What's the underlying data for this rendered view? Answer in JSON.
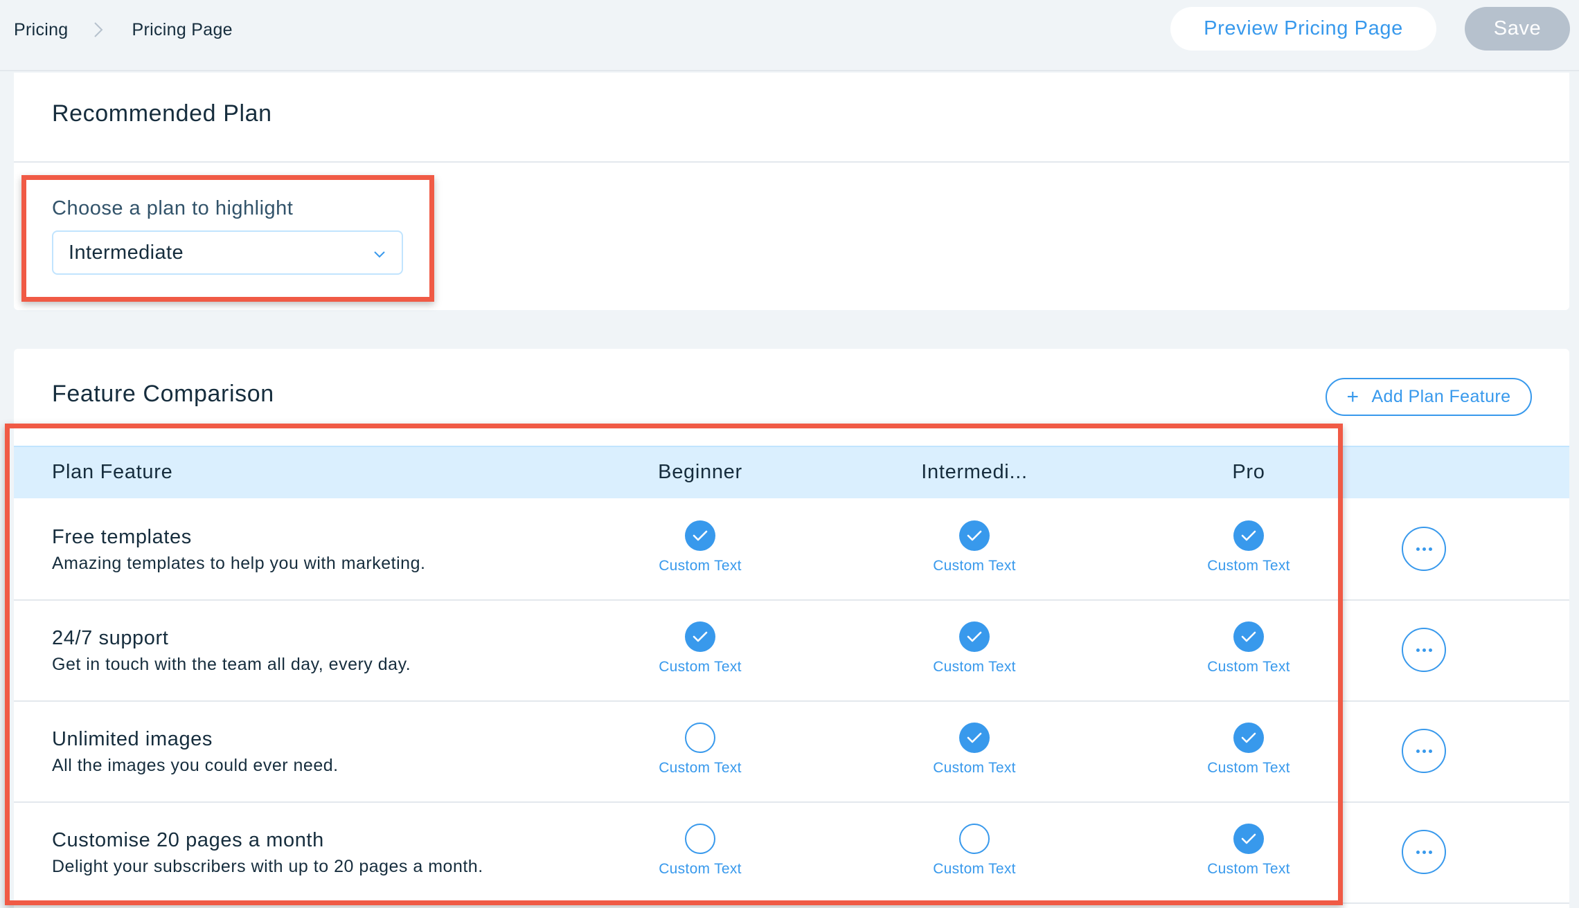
{
  "breadcrumb": {
    "items": [
      "Pricing",
      "Pricing Page"
    ]
  },
  "header": {
    "preview_label": "Preview Pricing Page",
    "save_label": "Save"
  },
  "recommended": {
    "title": "Recommended Plan",
    "choose_label": "Choose a plan to highlight",
    "selected_plan": "Intermediate"
  },
  "comparison": {
    "title": "Feature Comparison",
    "add_label": "Add Plan Feature",
    "columns": {
      "feature": "Plan Feature",
      "plans": [
        "Beginner",
        "Intermedi...",
        "Pro"
      ]
    },
    "rows": [
      {
        "title": "Free templates",
        "desc": "Amazing templates to help you with marketing.",
        "cells": [
          {
            "checked": true,
            "text": "Custom Text"
          },
          {
            "checked": true,
            "text": "Custom Text"
          },
          {
            "checked": true,
            "text": "Custom Text"
          }
        ]
      },
      {
        "title": "24/7 support",
        "desc": "Get in touch with the team all day, every day.",
        "cells": [
          {
            "checked": true,
            "text": "Custom Text"
          },
          {
            "checked": true,
            "text": "Custom Text"
          },
          {
            "checked": true,
            "text": "Custom Text"
          }
        ]
      },
      {
        "title": "Unlimited images",
        "desc": "All the images you could ever need.",
        "cells": [
          {
            "checked": false,
            "text": "Custom Text"
          },
          {
            "checked": true,
            "text": "Custom Text"
          },
          {
            "checked": true,
            "text": "Custom Text"
          }
        ]
      },
      {
        "title": "Customise 20 pages a month",
        "desc": "Delight your subscribers with up to 20 pages a month.",
        "cells": [
          {
            "checked": false,
            "text": "Custom Text"
          },
          {
            "checked": false,
            "text": "Custom Text"
          },
          {
            "checked": true,
            "text": "Custom Text"
          }
        ]
      }
    ]
  },
  "colors": {
    "accent": "#3899ec",
    "header_row": "#daeffe",
    "highlight_box": "#f05a45",
    "save_disabled": "#b6c1cd"
  },
  "icons": [
    "chevron-right-icon",
    "chevron-down-icon",
    "plus-icon",
    "checkmark-icon",
    "more-icon"
  ]
}
